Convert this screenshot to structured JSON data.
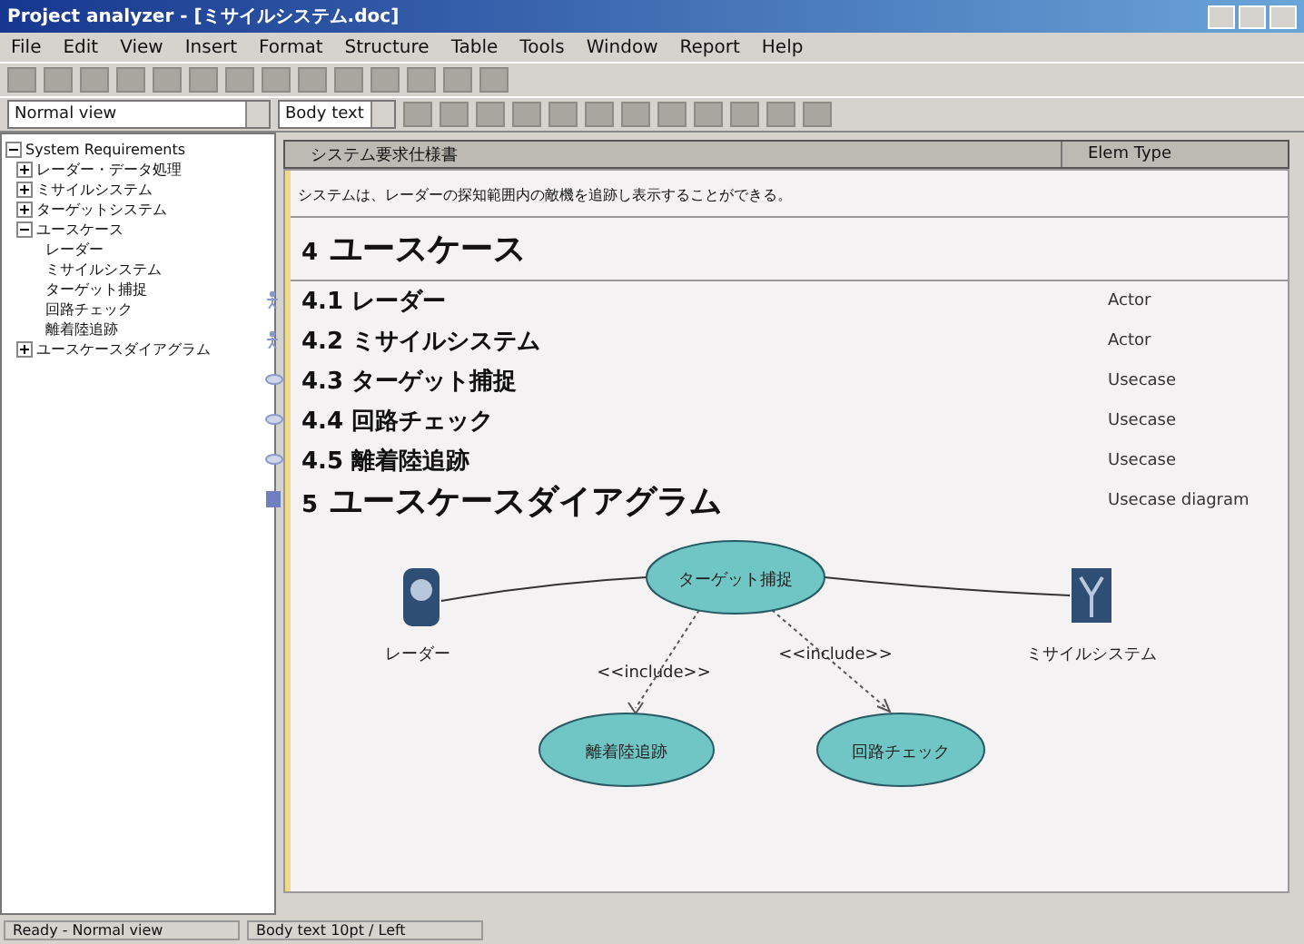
{
  "window": {
    "title": "Project analyzer - [ミサイルシステム.doc]"
  },
  "menu": [
    "File",
    "Edit",
    "View",
    "Insert",
    "Format",
    "Structure",
    "Table",
    "Tools",
    "Window",
    "Report",
    "Help"
  ],
  "view_select": {
    "value": "Normal view"
  },
  "style_select": {
    "value": "Body text"
  },
  "tree": [
    {
      "label": "System Requirements",
      "expanded": true,
      "children": [
        {
          "label": "レーダー・データ処理",
          "expanded": false
        },
        {
          "label": "ミサイルシステム",
          "expanded": false
        },
        {
          "label": "ターゲットシステム",
          "expanded": false
        },
        {
          "label": "ユースケース",
          "expanded": true,
          "children": [
            {
              "label": "レーダー"
            },
            {
              "label": "ミサイルシステム"
            },
            {
              "label": "ターゲット捕捉"
            },
            {
              "label": "回路チェック"
            },
            {
              "label": "離着陸追跡"
            }
          ]
        },
        {
          "label": "ユースケースダイアグラム",
          "expanded": false
        }
      ]
    }
  ],
  "document": {
    "columns": [
      "システム要求仕様書",
      "Elem Type"
    ],
    "intro": "システムは、レーダーの探知範囲内の敵機を追跡し表示することができる。",
    "rows": [
      {
        "kind": "heading",
        "number": "4",
        "title": "ユースケース"
      },
      {
        "kind": "actor",
        "number": "4.1",
        "title": "レーダー",
        "type": "Actor"
      },
      {
        "kind": "actor",
        "number": "4.2",
        "title": "ミサイルシステム",
        "type": "Actor"
      },
      {
        "kind": "usecase",
        "number": "4.3",
        "title": "ターゲット捕捉",
        "type": "Usecase"
      },
      {
        "kind": "usecase",
        "number": "4.4",
        "title": "回路チェック",
        "type": "Usecase"
      },
      {
        "kind": "usecase",
        "number": "4.5",
        "title": "離着陸追跡",
        "type": "Usecase"
      },
      {
        "kind": "diagram",
        "number": "5",
        "title": "ユースケースダイアグラム",
        "type": "Usecase diagram"
      }
    ]
  },
  "diagram": {
    "actors": [
      "レーダー",
      "ミサイルシステム"
    ],
    "main_usecase": "ターゲット捕捉",
    "included": [
      "離着陸追跡",
      "回路チェック"
    ],
    "relations": [
      "<<include>>",
      "<<include>>"
    ]
  },
  "status_bar": [
    "Ready - Normal view",
    "Body text 10pt / Left"
  ]
}
